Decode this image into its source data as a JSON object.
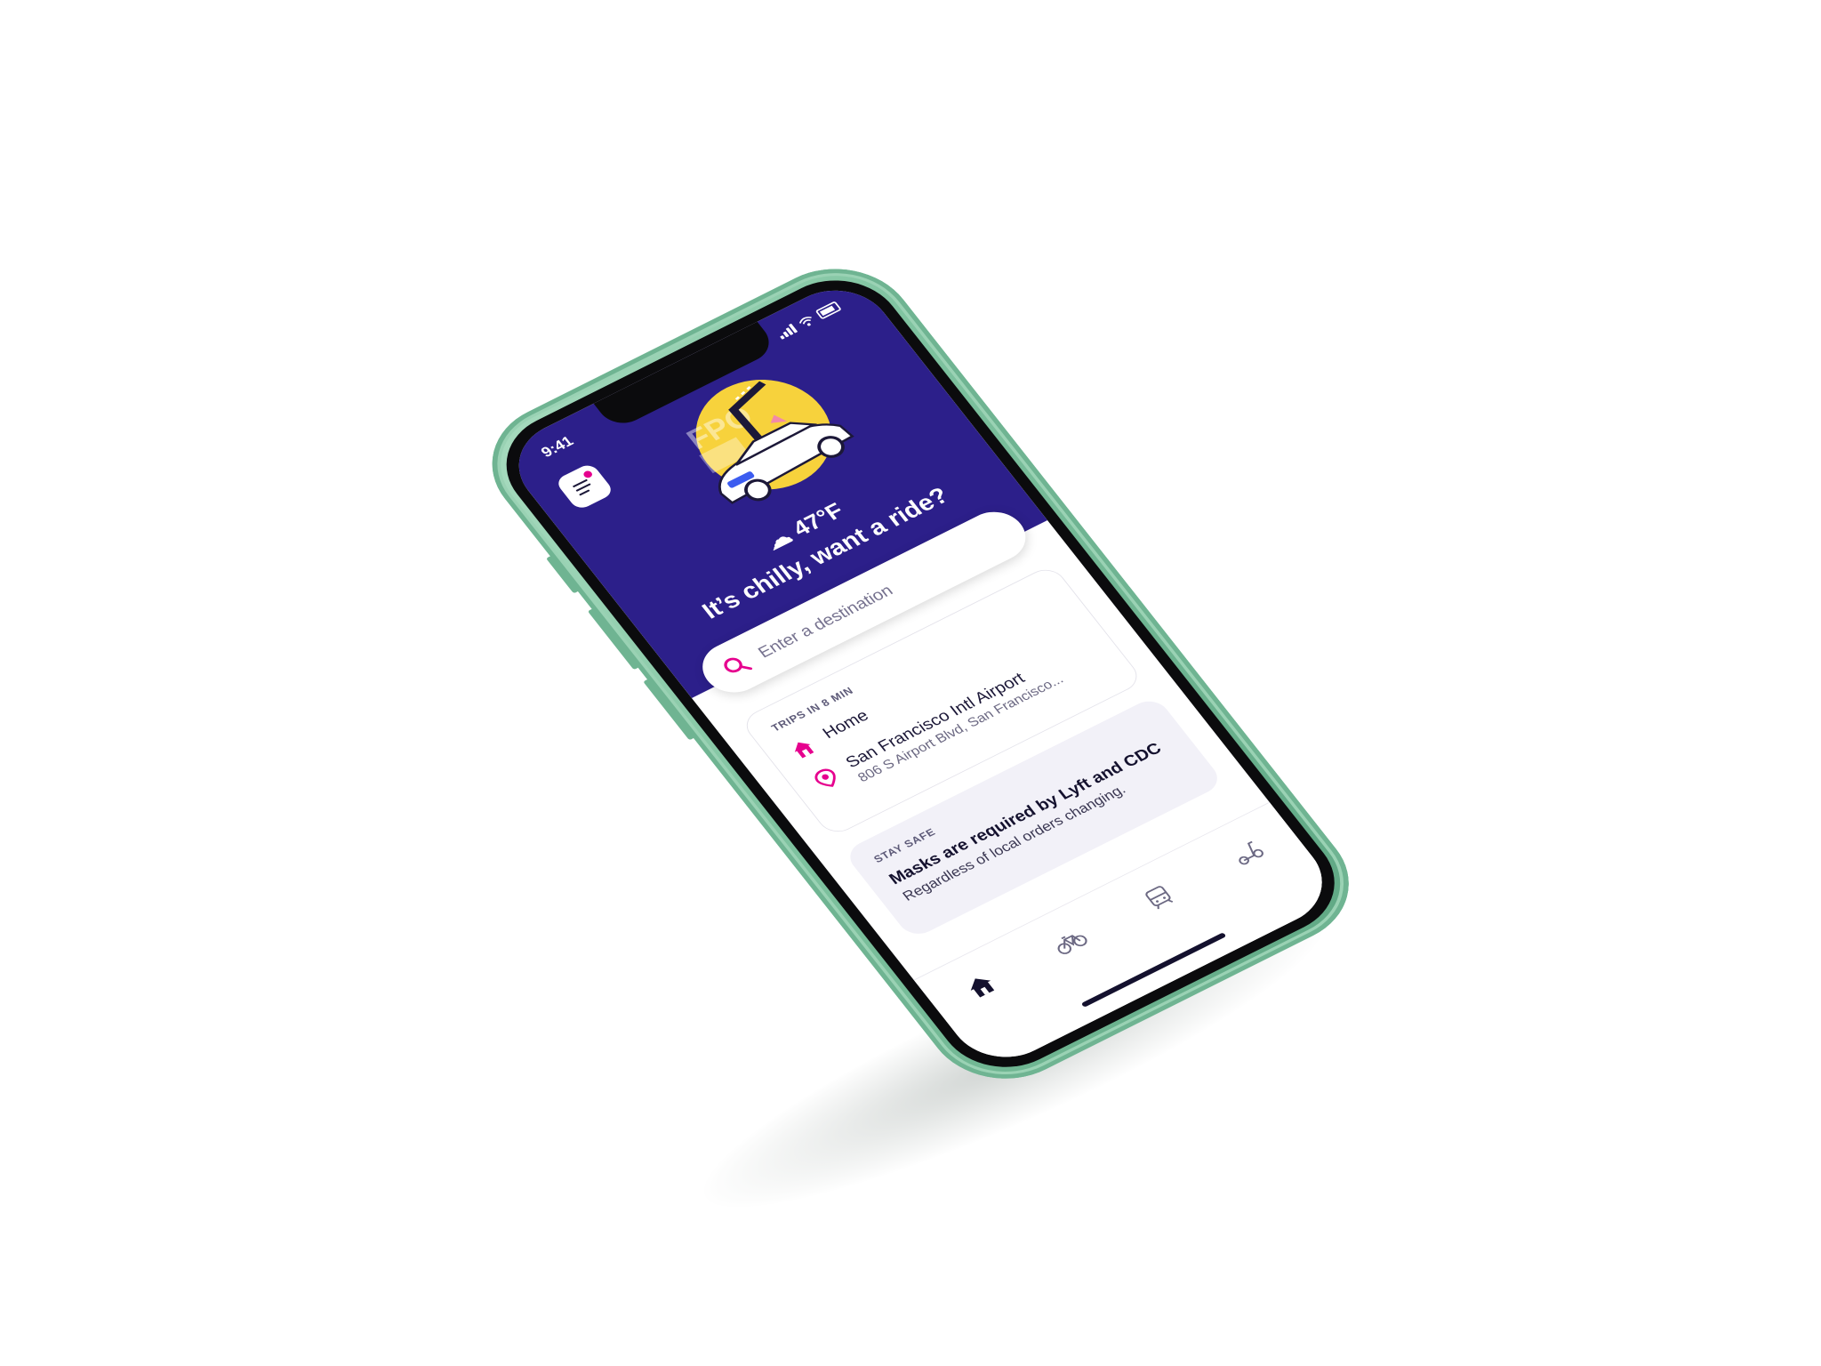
{
  "status_bar": {
    "time": "9:41"
  },
  "header": {
    "menu_icon": "hamburger-menu-icon",
    "illustration_watermark": "FPO",
    "weather_icon": "cloud-icon",
    "temperature": "47°F",
    "tagline": "It’s chilly, want a ride?"
  },
  "search": {
    "icon": "search-icon",
    "placeholder": "Enter a destination"
  },
  "trips": {
    "label": "TRIPS IN 8 MIN",
    "items": [
      {
        "icon": "home-icon",
        "title": "Home",
        "subtitle": ""
      },
      {
        "icon": "location-pin-icon",
        "title": "San Francisco Intl Airport",
        "subtitle": "806 S Airport Blvd, San Francisco..."
      }
    ]
  },
  "safety": {
    "label": "STAY SAFE",
    "title": "Masks are required by Lyft and CDC",
    "subtitle": "Regardless of local orders changing."
  },
  "tabs": [
    {
      "icon": "home-icon",
      "active": true
    },
    {
      "icon": "bike-icon",
      "active": false
    },
    {
      "icon": "transit-icon",
      "active": false
    },
    {
      "icon": "scooter-icon",
      "active": false
    }
  ],
  "colors": {
    "hero_bg": "#2c1f8a",
    "accent": "#e6008e",
    "phone_body": "#7fc3a0",
    "sun": "#f7d23c"
  }
}
